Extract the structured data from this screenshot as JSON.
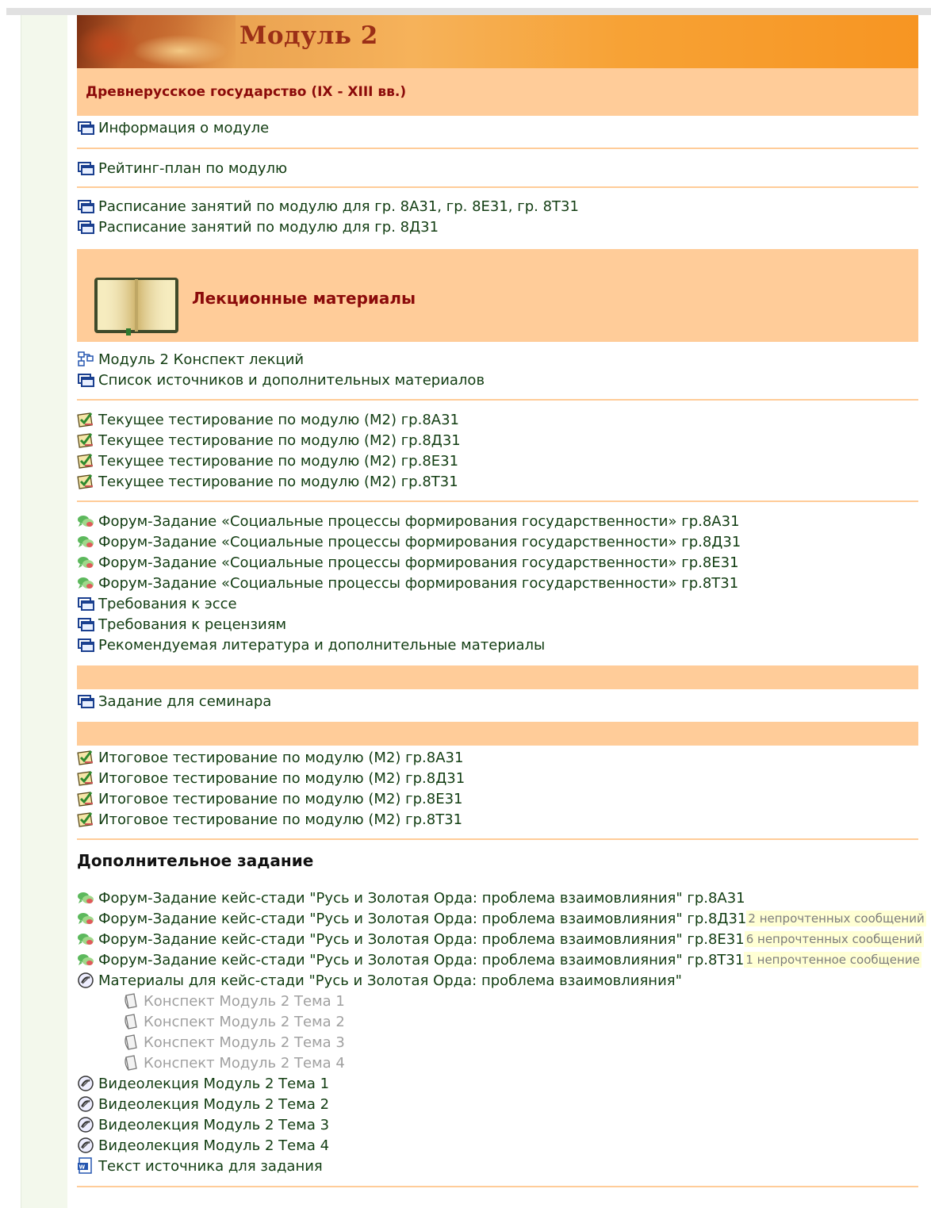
{
  "module": {
    "banner_title": "Модуль 2",
    "section_title": "Древнерусское государство (IX - XIII вв.)"
  },
  "info": [
    {
      "label": "Информация о модуле",
      "icon": "page-icon"
    },
    {
      "label": "Рейтинг-план по модулю",
      "icon": "page-icon"
    }
  ],
  "schedule": [
    {
      "label": "Расписание занятий по модулю для гр. 8А31, гр. 8Е31, гр. 8Т31",
      "icon": "page-icon"
    },
    {
      "label": "Расписание занятий по модулю для гр. 8Д31",
      "icon": "page-icon"
    }
  ],
  "lectures": {
    "title": "Лекционные материалы",
    "items": [
      {
        "label": "Модуль 2 Конспект лекций",
        "icon": "book-module-icon"
      },
      {
        "label": "Список источников и дополнительных материалов",
        "icon": "page-icon"
      }
    ]
  },
  "current_tests": [
    {
      "label": "Текущее тестирование по модулю (М2) гр.8А31",
      "icon": "quiz-icon"
    },
    {
      "label": "Текущее тестирование по модулю (М2) гр.8Д31",
      "icon": "quiz-icon"
    },
    {
      "label": "Текущее тестирование по модулю (М2) гр.8Е31",
      "icon": "quiz-icon"
    },
    {
      "label": "Текущее тестирование по модулю (М2) гр.8Т31",
      "icon": "quiz-icon"
    }
  ],
  "forums": [
    {
      "label": "Форум-Задание «Социальные процессы формирования государственности» гр.8А31",
      "icon": "forum-icon"
    },
    {
      "label": "Форум-Задание «Социальные процессы формирования государственности» гр.8Д31",
      "icon": "forum-icon"
    },
    {
      "label": "Форум-Задание «Социальные процессы формирования государственности» гр.8Е31",
      "icon": "forum-icon"
    },
    {
      "label": "Форум-Задание «Социальные процессы формирования государственности» гр.8Т31",
      "icon": "forum-icon"
    },
    {
      "label": "Требования к эссе",
      "icon": "page-icon"
    },
    {
      "label": "Требования к рецензиям",
      "icon": "page-icon"
    },
    {
      "label": "Рекомендуемая литература и дополнительные материалы",
      "icon": "page-icon"
    }
  ],
  "seminar": [
    {
      "label": "Задание для семинара",
      "icon": "page-icon"
    }
  ],
  "final_tests": [
    {
      "label": "Итоговое тестирование по модулю (М2) гр.8А31",
      "icon": "quiz-icon"
    },
    {
      "label": "Итоговое тестирование по модулю (М2) гр.8Д31",
      "icon": "quiz-icon"
    },
    {
      "label": "Итоговое тестирование по модулю (М2) гр.8Е31",
      "icon": "quiz-icon"
    },
    {
      "label": "Итоговое тестирование по модулю (М2) гр.8Т31",
      "icon": "quiz-icon"
    }
  ],
  "extra": {
    "title": "Дополнительное задание",
    "forums": [
      {
        "label": "Форум-Задание кейс-стади \"Русь и Золотая Орда: проблема взаимовлияния\" гр.8А31",
        "icon": "forum-icon",
        "unread": ""
      },
      {
        "label": "Форум-Задание кейс-стади \"Русь и Золотая Орда: проблема взаимовлияния\" гр.8Д31",
        "icon": "forum-icon",
        "unread": "2 непрочтенных сообщений"
      },
      {
        "label": "Форум-Задание кейс-стади \"Русь и Золотая Орда: проблема взаимовлияния\" гр.8Е31",
        "icon": "forum-icon",
        "unread": "6 непрочтенных сообщений"
      },
      {
        "label": "Форум-Задание кейс-стади \"Русь и Золотая Орда: проблема взаимовлияния\" гр.8Т31",
        "icon": "forum-icon",
        "unread": "1 непрочтенное сообщение"
      }
    ],
    "materials": {
      "label": "Материалы для кейс-стади \"Русь и Золотая Орда: проблема взаимовлияния\"",
      "icon": "folder-icon"
    },
    "materials_sub": [
      {
        "label": "Конспект Модуль 2 Тема 1",
        "icon": "file-icon"
      },
      {
        "label": "Конспект Модуль 2 Тема 2",
        "icon": "file-icon"
      },
      {
        "label": "Конспект Модуль 2 Тема 3",
        "icon": "file-icon"
      },
      {
        "label": "Конспект Модуль 2 Тема 4",
        "icon": "file-icon"
      }
    ],
    "videos": [
      {
        "label": "Видеолекция Модуль 2 Тема 1",
        "icon": "folder-icon"
      },
      {
        "label": "Видеолекция Модуль 2 Тема 2",
        "icon": "folder-icon"
      },
      {
        "label": "Видеолекция Модуль 2 Тема 3",
        "icon": "folder-icon"
      },
      {
        "label": "Видеолекция Модуль 2 Тема 4",
        "icon": "folder-icon"
      }
    ],
    "source_text": {
      "label": "Текст источника для задания",
      "icon": "word-doc-icon"
    }
  }
}
